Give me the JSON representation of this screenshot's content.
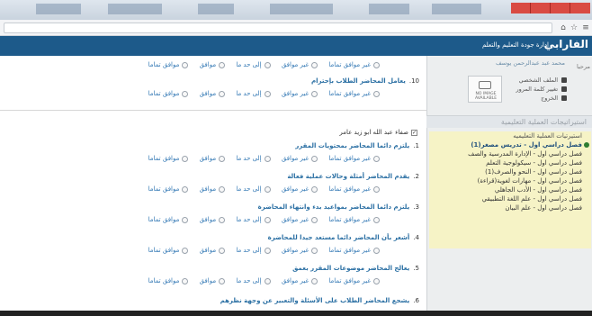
{
  "site": {
    "brand": "الفارابي",
    "tagline": "إدارة جودة التعليم والتعلم"
  },
  "user": {
    "welcome": "مرحبا",
    "name": "محمد عبد عبدالرحمن يوسف",
    "links": [
      "الملف الشخصي",
      "تغيير كلمة المرور",
      "الخروج"
    ],
    "no_image_caption": "NO IMAGE AVAILABLE"
  },
  "sidebar": {
    "box_title": "استيراتيجات العملية التعليمية",
    "items": [
      {
        "label": "استيرتيات العملية التعليميه",
        "kind": "head"
      },
      {
        "label": "فصل دراسي اول - تدريس مصغر(1)",
        "kind": "active"
      },
      {
        "label": "فصل دراسي اول - الإدارة المدرسية والصف",
        "kind": "normal"
      },
      {
        "label": "فصل دراسي اول - سيكولوجية التعلم",
        "kind": "normal"
      },
      {
        "label": "فصل دراسي اول - النحو والصرف(1)",
        "kind": "normal"
      },
      {
        "label": "فصل دراسي اول - مهارات لغوية(قراءة)",
        "kind": "normal"
      },
      {
        "label": "فصل دراسي اول - الأدب الجاهلي",
        "kind": "normal"
      },
      {
        "label": "فصل دراسي اول - علم اللغة التطبيقي",
        "kind": "normal"
      },
      {
        "label": "فصل دراسي اول - علم البيان",
        "kind": "normal"
      }
    ]
  },
  "options": [
    "غير موافق تماما",
    "غير موافق",
    "إلى حد ما",
    "موافق",
    "موافق تماما"
  ],
  "section": {
    "instructor": "صفاء عبد الله ابو زيد عامر"
  },
  "top_question": {
    "num": "10.",
    "text": "يعامل المحاضر الطلاب بإحترام"
  },
  "questions": [
    {
      "num": "1.",
      "text": "يلتزم دائما المحاضر بمحتويات المقرر"
    },
    {
      "num": "2.",
      "text": "يقدم المحاضر أمثلة وحالات عملية فعالة"
    },
    {
      "num": "3.",
      "text": "يلتزم دائما المحاضر بمواعيد بدء وانتهاء المحاضرة"
    },
    {
      "num": "4.",
      "text": "أشعر بأن المحاضر دائما مستعد جيدا للمحاضرة"
    },
    {
      "num": "5.",
      "text": "يعالج المحاضر موضوعات المقرر بعمق"
    },
    {
      "num": "6.",
      "text": "يشجع المحاضر الطلاب على الأسئلة والتعبير عن وجهة نظرهم"
    }
  ]
}
